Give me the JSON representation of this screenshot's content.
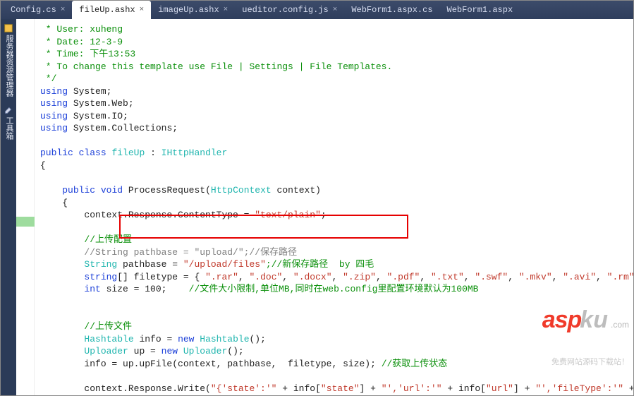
{
  "tabs": [
    {
      "label": "Config.cs",
      "closable": true
    },
    {
      "label": "fileUp.ashx",
      "closable": true,
      "active": true
    },
    {
      "label": "imageUp.ashx",
      "closable": true
    },
    {
      "label": "ueditor.config.js",
      "closable": true
    },
    {
      "label": "WebForm1.aspx.cs",
      "closable": false
    },
    {
      "label": "WebForm1.aspx",
      "closable": false
    }
  ],
  "close_glyph": "×",
  "sidebar": {
    "items": [
      {
        "name": "server-explorer",
        "label": "服务器资源管理器",
        "icon": "db-icon"
      },
      {
        "name": "toolbox",
        "label": "工具箱",
        "icon": "wrench-icon"
      }
    ]
  },
  "code": {
    "doc_comments": [
      " * User: xuheng",
      " * Date: 12-3-9",
      " * Time: 下午13:53",
      " * To change this template use File | Settings | File Templates.",
      " */"
    ],
    "kw_using": "using",
    "usings": [
      "System",
      "System.Web",
      "System.IO",
      "System.Collections"
    ],
    "kw_public": "public",
    "kw_class": "class",
    "kw_void": "void",
    "kw_new": "new",
    "kw_int": "int",
    "class_name": "fileUp",
    "iface": "IHttpHandler",
    "method": "ProcessRequest",
    "method_arg_type": "HttpContext",
    "method_arg": "context",
    "line_contenttype_pre": "context.Response.ContentType = ",
    "str_textplain": "\"text/plain\"",
    "c_upload_cfg": "//上传配置",
    "c_pathbase_old": "//String pathbase = \"upload/\";//保存路径",
    "type_string_cap": "String",
    "pathbase_assign": " pathbase = ",
    "str_pathbase": "\"/upload/files\"",
    "c_pathbase_new": ";//新保存路径  by 四毛",
    "kw_string": "string",
    "filetype_pre": "[] filetype = { ",
    "filetype_vals": [
      "\".rar\"",
      "\".doc\"",
      "\".docx\"",
      "\".zip\"",
      "\".pdf\"",
      "\".txt\"",
      "\".swf\"",
      "\".mkv\"",
      "\".avi\"",
      "\".rm\"",
      "\".rm"
    ],
    "size_line_mid": " size = 100;    ",
    "c_size": "//文件大小限制,单位MB,同时在web.config里配置环境默认为100MB",
    "c_upload_file": "//上传文件",
    "type_hashtable": "Hashtable",
    "hashtable_line_mid": " info = ",
    "hashtable_ctor": "();",
    "type_uploader": "Uploader",
    "uploader_line_mid": " up = ",
    "upfile_pre": "info = up.upFile(context, pathbase,  filetype, size); ",
    "c_upfile": "//获取上传状态",
    "write_pre": "context.Response.Write(",
    "str_state1": "\"{'state':'\"",
    "write_mid1": " + info[",
    "str_statekey": "\"state\"",
    "write_mid2": "] + ",
    "str_url1": "\"','url':'\"",
    "str_urlkey": "\"url\"",
    "str_filetype1": "\"','fileType':'\"",
    "write_tail": " + info["
  },
  "watermark": {
    "a": "asp",
    "b": "ku",
    "c": ".com",
    "sub": "免费网站源码下载站！"
  }
}
